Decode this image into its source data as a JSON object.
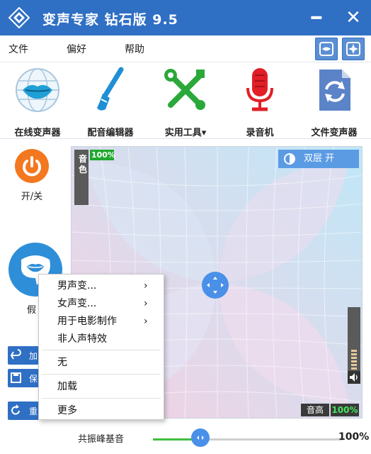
{
  "window": {
    "title": "变声专家  钻石版  9.5",
    "min_glyph": "━",
    "close_glyph": "✕"
  },
  "menu": {
    "file": "文件",
    "prefs": "偏好",
    "help": "帮助"
  },
  "toolbar": {
    "online": "在线变声器",
    "dubbing": "配音编辑器",
    "tools": "实用工具▾",
    "recorder": "录音机",
    "file_changer": "文件变声器"
  },
  "left": {
    "power": "开/关",
    "voice": "假",
    "btn1": "加",
    "btn2": "保",
    "btn3": "重"
  },
  "pad": {
    "timbre_label": "音色",
    "timbre_value": "100%",
    "dual_layer": "双层  开",
    "pitch_label": "音高",
    "pitch_value": "100%"
  },
  "resonance": {
    "label": "共振峰基音",
    "value": "100%",
    "level": 0.25
  },
  "context_menu": {
    "items": [
      {
        "label": "男声变...",
        "arrow": "›"
      },
      {
        "label": "女声变...",
        "arrow": "›"
      },
      {
        "label": "用于电影制作",
        "arrow": "›"
      },
      {
        "label": "非人声特效"
      },
      {
        "label": "无"
      },
      {
        "label": "加载"
      },
      {
        "label": "更多"
      }
    ]
  },
  "colors": {
    "titlebar": "#2f6fc4",
    "accent_green": "#3fbf3f",
    "power_orange": "#f3781f",
    "handle_blue": "#4a90e8"
  }
}
